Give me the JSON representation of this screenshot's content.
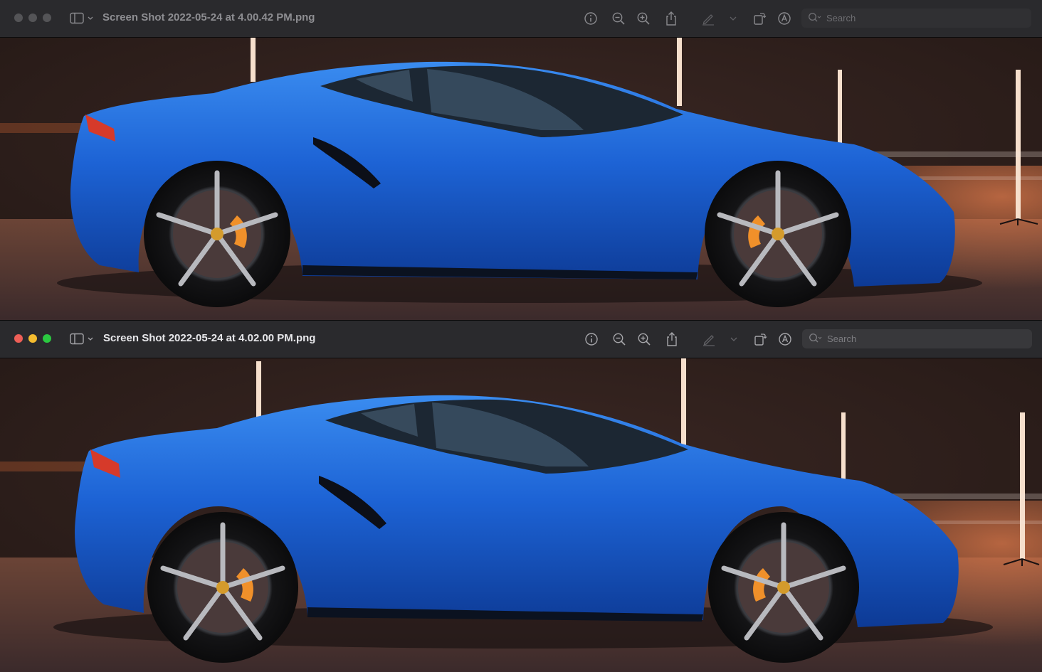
{
  "windows": [
    {
      "title": "Screen Shot 2022-05-24 at 4.00.42 PM.png",
      "state": "inactive",
      "search_placeholder": "Search",
      "image_alt": "Blue sports car side view"
    },
    {
      "title": "Screen Shot 2022-05-24 at 4.02.00 PM.png",
      "state": "active",
      "search_placeholder": "Search",
      "image_alt": "Blue sports car side view"
    }
  ],
  "toolbar_icons": [
    "sidebar-toggle-icon",
    "info-icon",
    "zoom-out-icon",
    "zoom-in-icon",
    "share-icon",
    "markup-pen-icon",
    "chevron-down-icon",
    "rotate-icon",
    "annotate-icon",
    "search-icon"
  ],
  "colors": {
    "car_body": "#1f63d6",
    "backdrop": "#3a2722",
    "floor_glow": "#d9774a",
    "brake_caliper": "#f0902a"
  }
}
